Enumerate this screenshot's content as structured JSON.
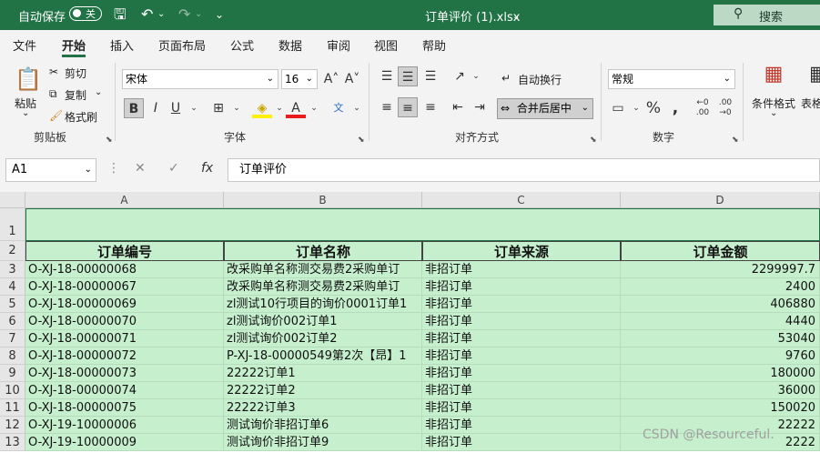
{
  "titlebar": {
    "autosave_label": "自动保存",
    "autosave_state": "关",
    "file_title": "订单评价 (1).xlsx",
    "search_label": "搜索"
  },
  "tabs": [
    "文件",
    "开始",
    "插入",
    "页面布局",
    "公式",
    "数据",
    "审阅",
    "视图",
    "帮助"
  ],
  "active_tab": "开始",
  "ribbon": {
    "clipboard": {
      "paste": "粘贴",
      "cut": "剪切",
      "copy": "复制",
      "format_painter": "格式刷",
      "group": "剪贴板"
    },
    "font": {
      "name": "宋体",
      "size": "16",
      "group": "字体"
    },
    "alignment": {
      "wrap_text": "自动换行",
      "merge_center": "合并后居中",
      "group": "对齐方式"
    },
    "number": {
      "format": "常规",
      "group": "数字"
    },
    "styles": {
      "conditional_format": "条件格式",
      "table_format": "表格格"
    }
  },
  "formula_bar": {
    "name_box": "A1",
    "formula": "订单评价"
  },
  "grid": {
    "columns": [
      "A",
      "B",
      "C",
      "D"
    ],
    "header_row": [
      "订单编号",
      "订单名称",
      "订单来源",
      "订单金额"
    ],
    "rows": [
      {
        "n": "3",
        "a": "O-XJ-18-00000068",
        "b": "改采购单名称测交易费2采购单订",
        "c": "非招订单",
        "d": "2299997.7"
      },
      {
        "n": "4",
        "a": "O-XJ-18-00000067",
        "b": "改采购单名称测交易费2采购单订",
        "c": "非招订单",
        "d": "2400"
      },
      {
        "n": "5",
        "a": "O-XJ-18-00000069",
        "b": "zl测试10行项目的询价0001订单1",
        "c": "非招订单",
        "d": "406880"
      },
      {
        "n": "6",
        "a": "O-XJ-18-00000070",
        "b": "zl测试询价002订单1",
        "c": "非招订单",
        "d": "4440"
      },
      {
        "n": "7",
        "a": "O-XJ-18-00000071",
        "b": "zl测试询价002订单2",
        "c": "非招订单",
        "d": "53040"
      },
      {
        "n": "8",
        "a": "O-XJ-18-00000072",
        "b": "P-XJ-18-00000549第2次【昂】1",
        "c": "非招订单",
        "d": "9760"
      },
      {
        "n": "9",
        "a": "O-XJ-18-00000073",
        "b": "22222订单1",
        "c": "非招订单",
        "d": "180000"
      },
      {
        "n": "10",
        "a": "O-XJ-18-00000074",
        "b": "22222订单2",
        "c": "非招订单",
        "d": "36000"
      },
      {
        "n": "11",
        "a": "O-XJ-18-00000075",
        "b": "22222订单3",
        "c": "非招订单",
        "d": "150020"
      },
      {
        "n": "12",
        "a": "O-XJ-19-10000006",
        "b": "测试询价非招订单6",
        "c": "非招订单",
        "d": "22222"
      },
      {
        "n": "13",
        "a": "O-XJ-19-10000009",
        "b": "测试询价非招订单9",
        "c": "非招订单",
        "d": "2222"
      }
    ]
  },
  "watermark": "CSDN @Resourceful.",
  "colors": {
    "brand": "#217346",
    "cell_fill": "#c6efce"
  }
}
